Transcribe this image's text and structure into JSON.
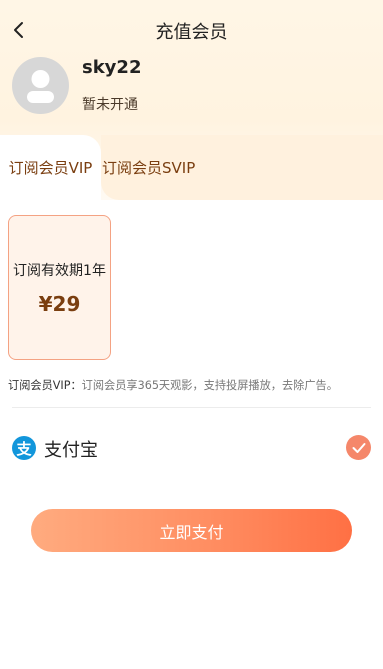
{
  "nav": {
    "title": "充值会员"
  },
  "user": {
    "name": "sky22",
    "status": "暂未开通"
  },
  "tabs": [
    {
      "label": "订阅会员VIP",
      "active": true
    },
    {
      "label": "订阅会员SVIP",
      "active": false
    }
  ],
  "plans": [
    {
      "duration": "订阅有效期1年",
      "price": "¥29",
      "selected": true
    }
  ],
  "description": {
    "label": "订阅会员VIP：",
    "text": "订阅会员享365天观影，支持投屏播放，去除广告。"
  },
  "payment": {
    "method": "支付宝",
    "selected": true
  },
  "pay_button": {
    "label": "立即支付"
  },
  "colors": {
    "accent": "#ff7a4e",
    "tab_text": "#7a3e10",
    "alipay_blue": "#1296db",
    "check": "#f5876a"
  }
}
